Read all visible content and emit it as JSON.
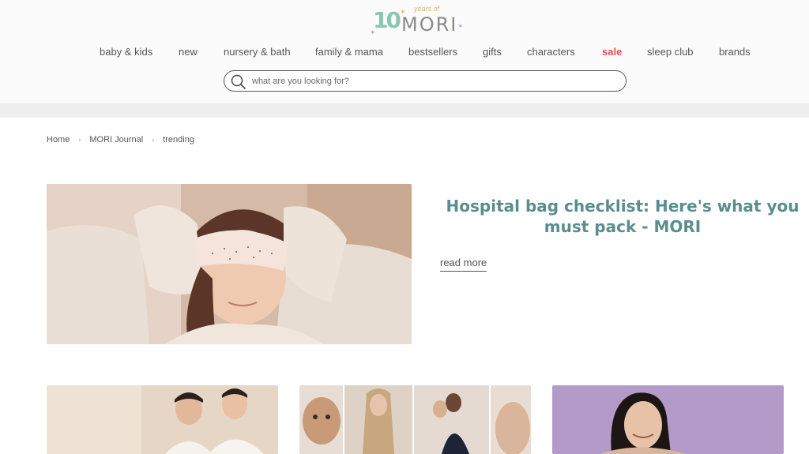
{
  "logo": {
    "number": "10",
    "tagline": "years of",
    "brand": "MORI",
    "colors": {
      "number": "#8bc6b1",
      "tagline": "#e8b56a",
      "brand": "#8a8a8a"
    }
  },
  "nav": {
    "items": [
      {
        "label": "baby & kids"
      },
      {
        "label": "new"
      },
      {
        "label": "nursery & bath"
      },
      {
        "label": "family & mama"
      },
      {
        "label": "bestsellers"
      },
      {
        "label": "gifts"
      },
      {
        "label": "characters"
      },
      {
        "label": "sale",
        "color": "#d9534f"
      },
      {
        "label": "sleep club"
      },
      {
        "label": "brands"
      }
    ]
  },
  "search": {
    "placeholder": "what are you looking for?",
    "value": "",
    "icon": "search-icon"
  },
  "breadcrumb": {
    "items": [
      {
        "label": "Home"
      },
      {
        "label": "MORI Journal"
      },
      {
        "label": "trending"
      }
    ],
    "separator": "›"
  },
  "hero": {
    "title": "Hospital bag checklist: Here's what you must pack - MORI",
    "read_more": "read more",
    "title_color": "#5a8e8e"
  }
}
